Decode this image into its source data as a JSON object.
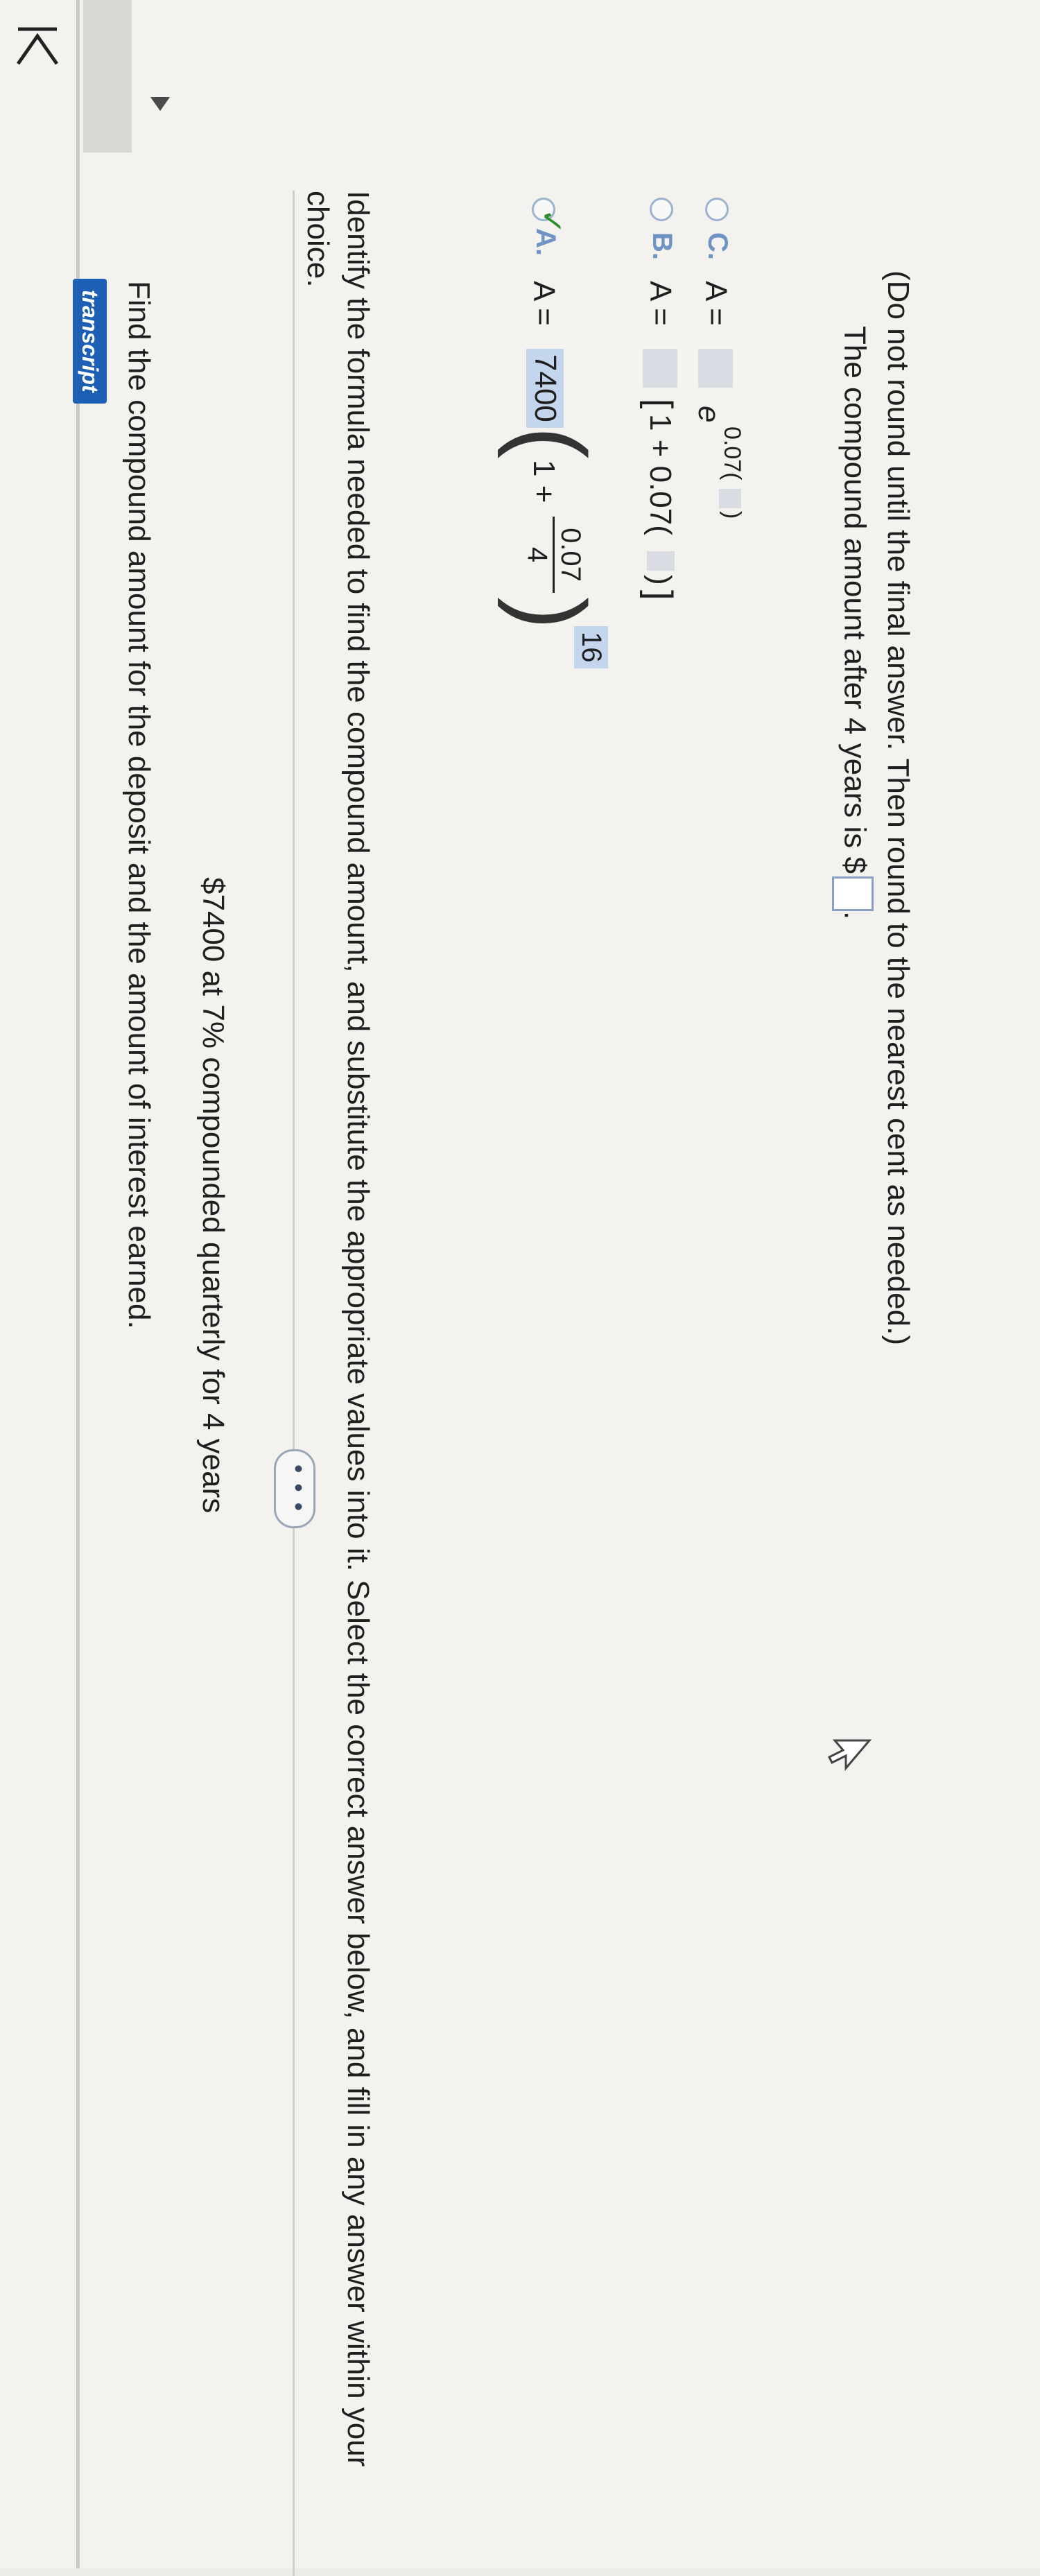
{
  "header": {
    "badge": "transcript",
    "question": "Find the compound amount for the deposit and the amount of interest earned.",
    "given": "$7400 at 7% compounded quarterly for 4 years"
  },
  "more_label": "• • •",
  "instruction": "Identify the formula needed to find the compound amount, and substitute the appropriate values into it. Select the correct answer below, and fill in any answer within your choice.",
  "options": {
    "a": {
      "letter": "A.",
      "lhs": "A =",
      "principal": "7400",
      "one_plus": "1 +",
      "numerator": "0.07",
      "denominator": "4",
      "exponent": "16"
    },
    "b": {
      "letter": "B.",
      "lhs": "A =",
      "bracket_open": "[",
      "inner": "1 + 0.07(",
      "inner_close": ")",
      "bracket_close": "]"
    },
    "c": {
      "letter": "C.",
      "lhs": "A =",
      "e": "e",
      "exp": "0.07(",
      "exp_close": ")"
    }
  },
  "result": {
    "text": "The compound amount after 4 years is $",
    "suffix": "."
  },
  "note": "(Do not round until the final answer. Then round to the nearest cent as needed.)",
  "colors": {
    "badge": "#1d5fb5",
    "selected_fill": "#c4d6ee",
    "check": "#2f8f2f",
    "option_letter": "#6e93c4"
  }
}
